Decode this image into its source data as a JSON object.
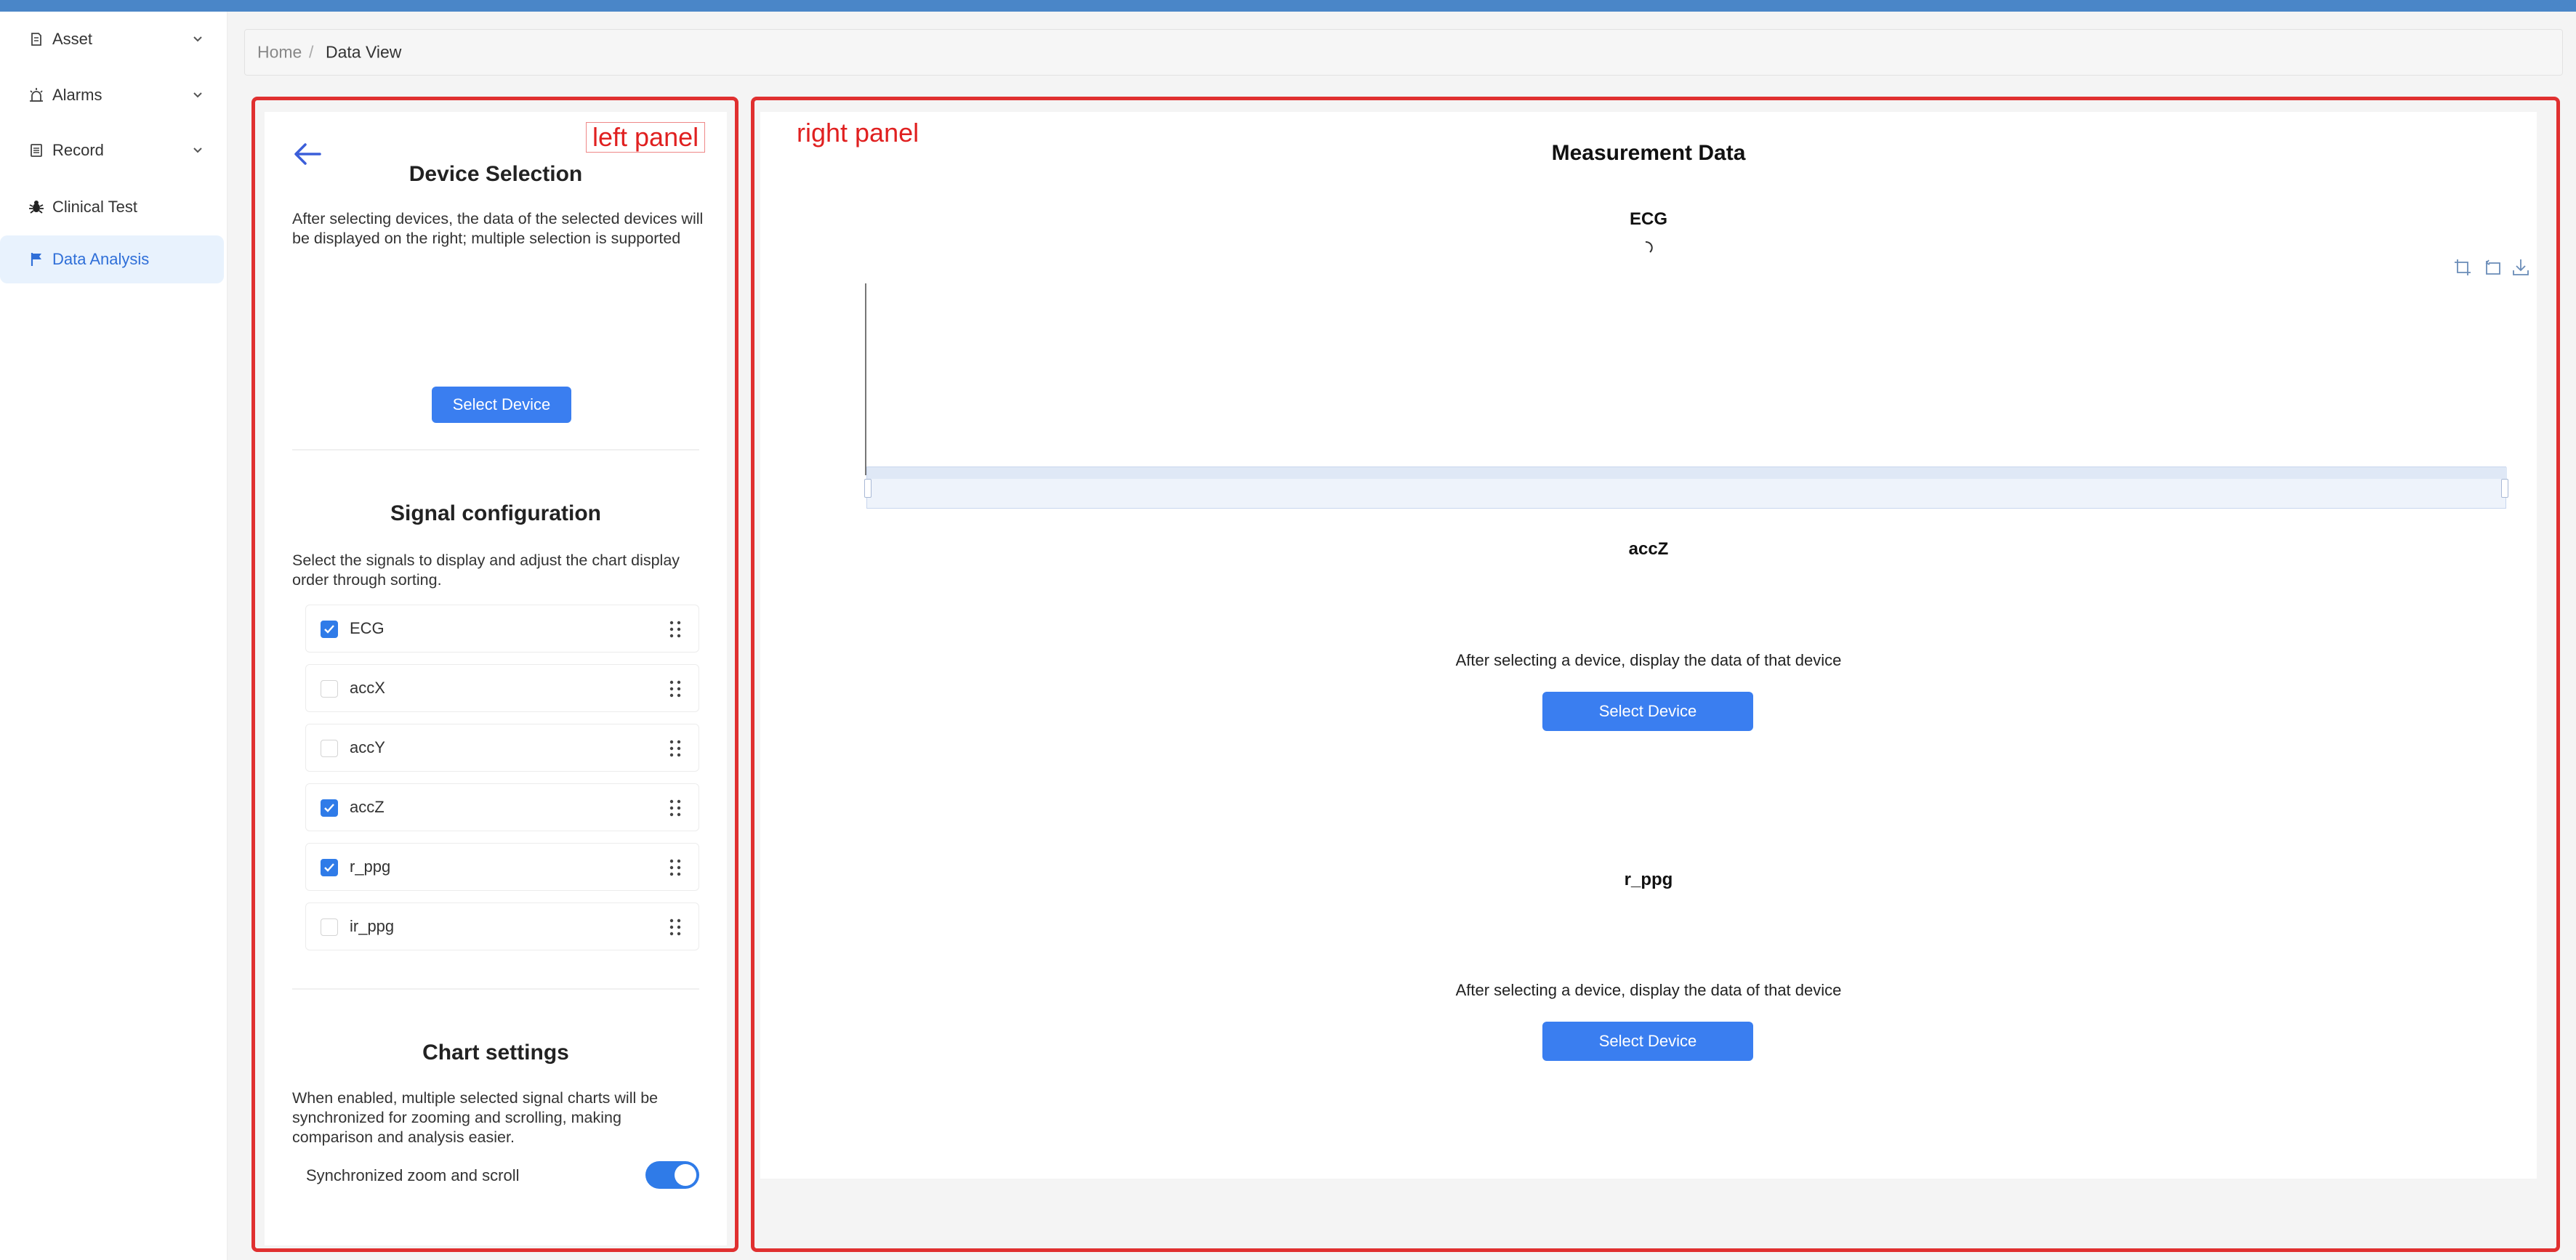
{
  "sidebar": {
    "items": [
      {
        "label": "Asset",
        "icon": "asset-icon",
        "expandable": true
      },
      {
        "label": "Alarms",
        "icon": "alarm-icon",
        "expandable": true
      },
      {
        "label": "Record",
        "icon": "record-icon",
        "expandable": true
      },
      {
        "label": "Clinical Test",
        "icon": "bug-icon",
        "expandable": false
      },
      {
        "label": "Data Analysis",
        "icon": "flag-icon",
        "expandable": false,
        "active": true
      }
    ]
  },
  "breadcrumb": {
    "home": "Home",
    "separator": "/",
    "current": "Data View"
  },
  "left_panel": {
    "annotation": "left panel",
    "device_selection": {
      "title": "Device Selection",
      "description": "After selecting devices, the data of the selected devices will be displayed on the right; multiple selection is supported",
      "button": "Select Device"
    },
    "signal_configuration": {
      "title": "Signal configuration",
      "description": "Select the signals to display and adjust the chart display order through sorting.",
      "signals": [
        {
          "name": "ECG",
          "checked": true
        },
        {
          "name": "accX",
          "checked": false
        },
        {
          "name": "accY",
          "checked": false
        },
        {
          "name": "accZ",
          "checked": true
        },
        {
          "name": "r_ppg",
          "checked": true
        },
        {
          "name": "ir_ppg",
          "checked": false
        }
      ]
    },
    "chart_settings": {
      "title": "Chart settings",
      "description": "When enabled, multiple selected signal charts will be synchronized for zooming and scrolling, making comparison and analysis easier.",
      "toggle_label": "Synchronized zoom and scroll",
      "toggle_on": true
    }
  },
  "right_panel": {
    "annotation": "right panel",
    "title": "Measurement Data",
    "charts": [
      {
        "name": "ECG",
        "state": "loading"
      },
      {
        "name": "accZ",
        "state": "empty",
        "message": "After selecting a device, display the data of that device",
        "button": "Select Device"
      },
      {
        "name": "r_ppg",
        "state": "empty",
        "message": "After selecting a device, display the data of that device",
        "button": "Select Device"
      }
    ]
  },
  "colors": {
    "accent": "#3a7ef0",
    "annotation": "#e03030",
    "topbar": "#4a86c8",
    "active_bg": "#e8f2fd"
  }
}
